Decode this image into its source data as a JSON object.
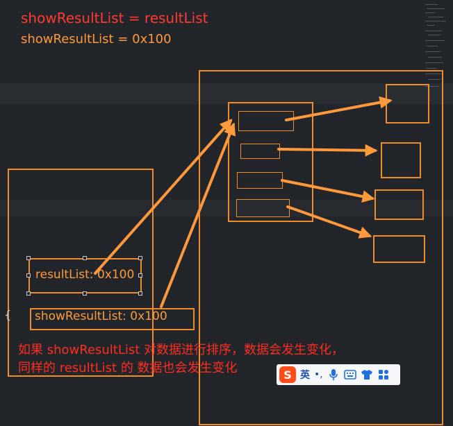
{
  "code_lines": {
    "line1": "showResultList = resultList",
    "line2": "showResultList = 0x100"
  },
  "variables": {
    "result_list": "resultList: 0x100",
    "show_result_list": "showResultList: 0x100"
  },
  "note": {
    "line1": "如果 showResultList 对数据进行排序，数据会发生变化，",
    "line2": "同样的 resultList 的 数据也会发生变化"
  },
  "ime_toolbar": {
    "logo": "S",
    "lang": "英",
    "punct": "•,",
    "icons": [
      "microphone-icon",
      "keyboard-icon",
      "shirt-icon",
      "grid-icon"
    ]
  },
  "colors": {
    "background": "#22262b",
    "accent_orange": "#f28c28",
    "text_red": "#ff3b30",
    "arrow": "#ff9a3c"
  }
}
